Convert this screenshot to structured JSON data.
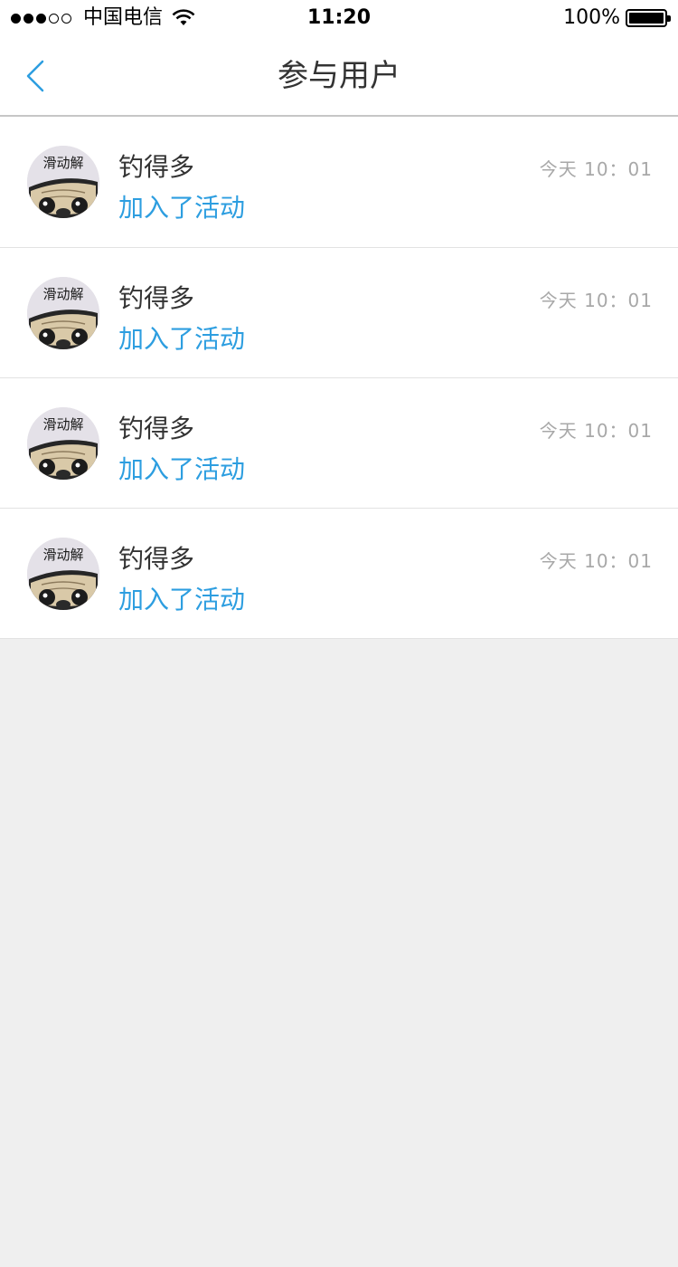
{
  "status_bar": {
    "carrier": "中国电信",
    "time": "11:20",
    "battery_percent": "100%",
    "signal_dots_filled": 3,
    "signal_dots_total": 5
  },
  "nav": {
    "title": "参与用户",
    "back_icon": "chevron-left-icon",
    "accent_color": "#2d9ee0"
  },
  "avatar_caption": "滑动解",
  "participants": [
    {
      "name": "钓得多",
      "action": "加入了活动",
      "time": "今天 10：01"
    },
    {
      "name": "钓得多",
      "action": "加入了活动",
      "time": "今天 10：01"
    },
    {
      "name": "钓得多",
      "action": "加入了活动",
      "time": "今天 10：01"
    },
    {
      "name": "钓得多",
      "action": "加入了活动",
      "time": "今天 10：01"
    }
  ]
}
